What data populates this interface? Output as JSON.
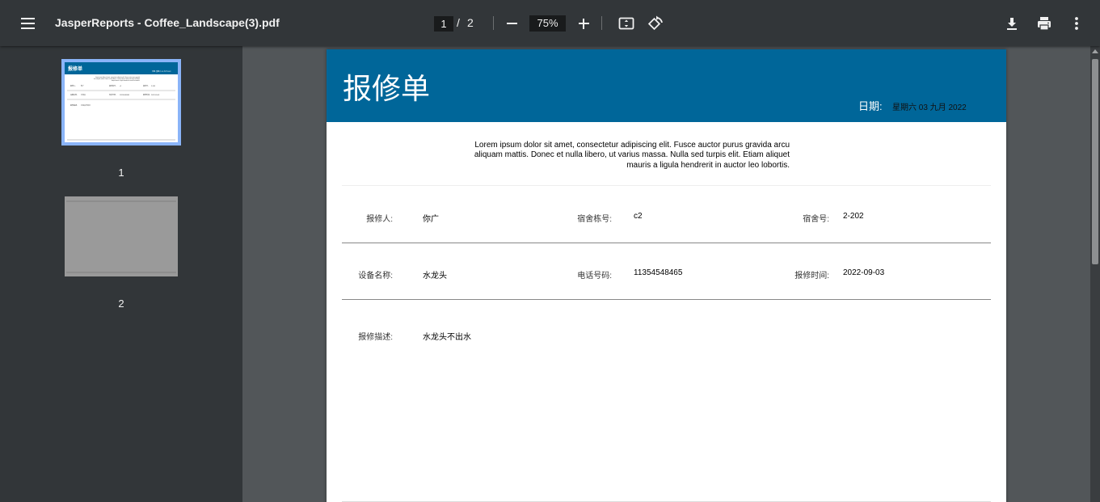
{
  "toolbar": {
    "title": "JasperReports - Coffee_Landscape(3).pdf",
    "current_page": "1",
    "separator": "/",
    "total_pages": "2",
    "zoom": "75%"
  },
  "sidebar": {
    "thumbnails": [
      {
        "label": "1",
        "selected": true
      },
      {
        "label": "2",
        "selected": false
      }
    ],
    "thumb_text": {
      "title": "报修单",
      "date": "日期: 星期六 03 九月 2022",
      "lorem1": "Lorem ipsum dolor sit amet, consectetur adipiscing elit. Fusce auctor purus gravida",
      "lorem2": "arcu aliquam mattis. Donec et nulla libero, ut varius massa. Nulla sed turpis elit. Etiam",
      "lorem3": "aliquet mauris a ligula hendrerit in auctor leo lobortis.",
      "r1a": "报修人:",
      "r1b": "你广",
      "r1c": "宿舍栋号:",
      "r1d": "c2",
      "r1e": "宿舍号:",
      "r1f": "2-202",
      "r2a": "设备名称:",
      "r2b": "水龙头",
      "r2c": "电话号码:",
      "r2d": "11354548465",
      "r2e": "报修时间:",
      "r2f": "2022-09-03",
      "r3a": "报修描述:",
      "r3b": "水龙头不出水"
    }
  },
  "report": {
    "title": "报修单",
    "date_label": "日期:",
    "date_value": "星期六 03 九月 2022",
    "lorem": "Lorem ipsum dolor sit amet, consectetur adipiscing elit. Fusce auctor purus gravida arcu aliquam mattis. Donec et nulla libero, ut varius massa. Nulla sed turpis elit. Etiam aliquet mauris a ligula hendrerit in auctor leo lobortis.",
    "fields": {
      "reporter_label": "报修人:",
      "reporter_value": "你广",
      "building_label": "宿舍栋号:",
      "building_value": "c2",
      "room_label": "宿舍号:",
      "room_value": "2-202",
      "device_label": "设备名称:",
      "device_value": "水龙头",
      "phone_label": "电话号码:",
      "phone_value": "11354548465",
      "time_label": "报修时间:",
      "time_value": "2022-09-03",
      "desc_label": "报修描述:",
      "desc_value": "水龙头不出水"
    }
  },
  "colors": {
    "header": "#006699",
    "toolbar": "#323639",
    "viewer_bg": "#525659",
    "thumb_selected": "#8ab4f8"
  },
  "icons": [
    "menu-icon",
    "zoom-out-icon",
    "zoom-in-icon",
    "fit-page-icon",
    "rotate-icon",
    "download-icon",
    "print-icon",
    "more-vert-icon"
  ]
}
